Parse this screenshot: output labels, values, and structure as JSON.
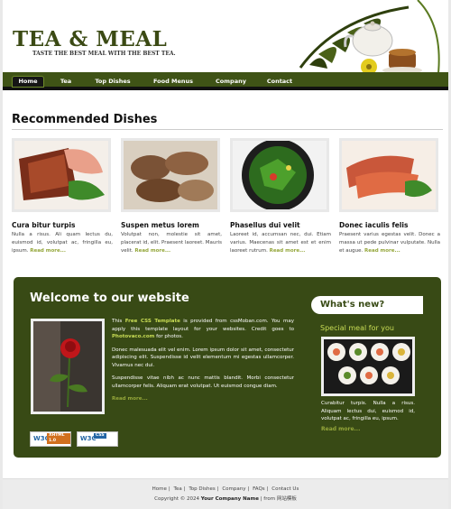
{
  "header": {
    "logo": "TEA & MEAL",
    "slogan": "TASTE THE BEST MEAL WITH THE BEST TEA."
  },
  "nav": {
    "items": [
      {
        "label": "Home"
      },
      {
        "label": "Tea"
      },
      {
        "label": "Top Dishes"
      },
      {
        "label": "Food Menus"
      },
      {
        "label": "Company"
      },
      {
        "label": "Contact"
      }
    ]
  },
  "recommended": {
    "title": "Recommended Dishes",
    "dishes": [
      {
        "title": "Cura bitur turpis",
        "text": "Nulla a risus. Ali quam lectus du, euismod id, volutpat ac, fringilla eu, ipsum.",
        "more": "Read more..."
      },
      {
        "title": "Suspen metus lorem",
        "text": "Volutpat non, molestie sit amet, placerat id, elit. Praesent laoreet. Mauris velit.",
        "more": "Read more..."
      },
      {
        "title": "Phasellus dui velit",
        "text": "Laoreet id, accumsan nec, dui. Etiam varius. Maecenas sit amet est et enim laoreet rutrum.",
        "more": "Read more..."
      },
      {
        "title": "Donec iaculis felis",
        "text": "Praesent varius egestas velit. Donec a massa ut pede pulvinar vulputate. Nulla et augue.",
        "more": "Read more..."
      }
    ]
  },
  "welcome": {
    "title": "Welcome to our website",
    "p1_a": "This ",
    "p1_link1": "Free CSS Template",
    "p1_b": " is provided from cssMoban.com. You may apply this template layout for your websites. Credit goes to ",
    "p1_link2": "Photovaco.com",
    "p1_c": " for photos.",
    "p2": "Donec malesuada elit vel enim. Lorem ipsum dolor sit amet, consectetur adipiscing elit. Suspendisse id velit elementum mi egestas ullamcorper. Vivamus nec dui.",
    "p3": "Suspendisse vitae nibh ac nunc mattis blandit. Morbi consectetur ullamcorper felis. Aliquam erat volutpat. Ut euismod congue diam.",
    "more": "Read more...",
    "badges": [
      {
        "label": "W3C",
        "sub": "XHTML 1.0"
      },
      {
        "label": "W3C",
        "sub": "CSS"
      }
    ]
  },
  "sidebar": {
    "tab_title": "What's new?",
    "special_title": "Special meal for you",
    "special_text": "Curabitur turpis. Nulla a risus. Aliquam lectus dui, euismod id, volutpat ac, fringilla eu, ipsum.",
    "more": "Read more..."
  },
  "footer": {
    "links": [
      "Home",
      "Tea",
      "Top Dishes",
      "Company",
      "FAQs",
      "Contact Us"
    ],
    "copy_prefix": "Copyright © 2024 ",
    "company": "Your Company Name",
    "copy_suffix": " | from 网站模板"
  },
  "colors": {
    "brand_green": "#3f5316",
    "panel_green": "#384a15",
    "accent_yellow_green": "#c9dd55",
    "more_link": "#94a63a"
  }
}
